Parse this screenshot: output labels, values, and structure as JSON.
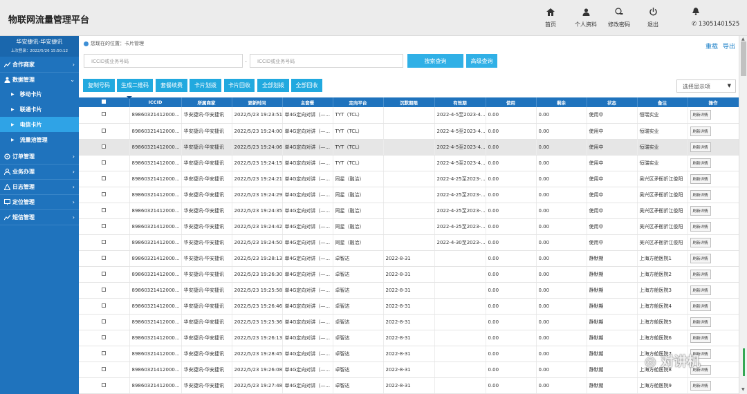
{
  "header": {
    "title": "物联网流量管理平台",
    "nav": [
      {
        "label": "首页",
        "icon": "home-icon"
      },
      {
        "label": "个人资料",
        "icon": "user-icon"
      },
      {
        "label": "修改密码",
        "icon": "key-icon"
      },
      {
        "label": "退出",
        "icon": "power-icon"
      }
    ],
    "phone": "13051401525"
  },
  "sidebar": {
    "user": "华安捷讯-华安捷讯",
    "last_login": "上次登录：2022/5/26 15:50:12",
    "items": [
      {
        "label": "合作商家"
      },
      {
        "label": "数据管理"
      },
      {
        "label": "订单管理"
      },
      {
        "label": "业务办理"
      },
      {
        "label": "日志管理"
      },
      {
        "label": "定位管理"
      },
      {
        "label": "短信管理"
      }
    ],
    "subitems": [
      {
        "label": "移动卡片"
      },
      {
        "label": "联通卡片"
      },
      {
        "label": "电信卡片"
      },
      {
        "label": "流量池管理"
      }
    ]
  },
  "breadcrumb": "您现在的位置：卡片管理",
  "top_links": {
    "refresh": "重载",
    "export": "导出"
  },
  "search": {
    "placeholder1": "ICCID或业务号码",
    "placeholder2": "ICCID或业务号码",
    "star": "-",
    "search_btn": "搜索查询",
    "advanced_btn": "高级查询"
  },
  "toolbar": [
    "复制号码",
    "生成二维码",
    "套餐续费",
    "卡片划拨",
    "卡片回收",
    "全部划拨",
    "全部回收"
  ],
  "display_select": "选择显示项",
  "table": {
    "columns": [
      "ICCID",
      "所属商家",
      "更新时间",
      "主套餐",
      "定向平台",
      "沉默期限",
      "有效期",
      "使用",
      "剩余",
      "状态",
      "备注",
      "操作"
    ],
    "action_label": "刷新详情",
    "rows": [
      {
        "iccid": "89860321412000...",
        "merchant": "华安捷讯-华安捷讯",
        "time": "2022/5/23 19:23:51",
        "plan": "单4G定向对讲（—...",
        "platform": "TYT（TCL）",
        "silent": "",
        "valid": "2022-4-5至2023-4...",
        "used": "0.00",
        "remain": "0.00",
        "status": "使用中",
        "note": "恒瑞实业"
      },
      {
        "iccid": "89860321412000...",
        "merchant": "华安捷讯-华安捷讯",
        "time": "2022/5/23 19:24:00",
        "plan": "单4G定向对讲（—...",
        "platform": "TYT（TCL）",
        "silent": "",
        "valid": "2022-4-5至2023-4...",
        "used": "0.00",
        "remain": "0.00",
        "status": "使用中",
        "note": "恒瑞实业"
      },
      {
        "iccid": "89860321412000...",
        "merchant": "华安捷讯-华安捷讯",
        "time": "2022/5/23 19:24:06",
        "plan": "单4G定向对讲（—...",
        "platform": "TYT（TCL）",
        "silent": "",
        "valid": "2022-4-5至2023-4...",
        "used": "0.00",
        "remain": "0.00",
        "status": "使用中",
        "note": "恒瑞实业"
      },
      {
        "iccid": "89860321412000...",
        "merchant": "华安捷讯-华安捷讯",
        "time": "2022/5/23 19:24:15",
        "plan": "单4G定向对讲（—...",
        "platform": "TYT（TCL）",
        "silent": "",
        "valid": "2022-4-5至2023-4...",
        "used": "0.00",
        "remain": "0.00",
        "status": "使用中",
        "note": "恒瑞实业"
      },
      {
        "iccid": "89860321412000...",
        "merchant": "华安捷讯-华安捷讯",
        "time": "2022/5/23 19:24:21",
        "plan": "单4G定向对讲（—...",
        "platform": "同星（融洽）",
        "silent": "",
        "valid": "2022-4-25至2023-...",
        "used": "0.00",
        "remain": "0.00",
        "status": "使用中",
        "note": "吴兴区矛衙折江俊阳"
      },
      {
        "iccid": "89860321412000...",
        "merchant": "华安捷讯-华安捷讯",
        "time": "2022/5/23 19:24:29",
        "plan": "单4G定向对讲（—...",
        "platform": "同星（融洽）",
        "silent": "",
        "valid": "2022-4-25至2023-...",
        "used": "0.00",
        "remain": "0.00",
        "status": "使用中",
        "note": "吴兴区矛衙折江俊阳"
      },
      {
        "iccid": "89860321412000...",
        "merchant": "华安捷讯-华安捷讯",
        "time": "2022/5/23 19:24:35",
        "plan": "单4G定向对讲（—...",
        "platform": "同星（融洽）",
        "silent": "",
        "valid": "2022-4-25至2023-...",
        "used": "0.00",
        "remain": "0.00",
        "status": "使用中",
        "note": "吴兴区矛衙折江俊阳"
      },
      {
        "iccid": "89860321412000...",
        "merchant": "华安捷讯-华安捷讯",
        "time": "2022/5/23 19:24:42",
        "plan": "单4G定向对讲（—...",
        "platform": "同星（融洽）",
        "silent": "",
        "valid": "2022-4-25至2023-...",
        "used": "0.00",
        "remain": "0.00",
        "status": "使用中",
        "note": "吴兴区矛衙折江俊阳"
      },
      {
        "iccid": "89860321412000...",
        "merchant": "华安捷讯-华安捷讯",
        "time": "2022/5/23 19:24:50",
        "plan": "单4G定向对讲（—...",
        "platform": "同星（融洽）",
        "silent": "",
        "valid": "2022-4-30至2023-...",
        "used": "0.00",
        "remain": "0.00",
        "status": "使用中",
        "note": "吴兴区矛衙折江俊阳"
      },
      {
        "iccid": "89860321412000...",
        "merchant": "华安捷讯-华安捷讯",
        "time": "2022/5/23 19:28:13",
        "plan": "单4G定向对讲（—...",
        "platform": "卓智达",
        "silent": "2022-8-31",
        "valid": "",
        "used": "0.00",
        "remain": "0.00",
        "status": "静默期",
        "note": "上海方舱医院1"
      },
      {
        "iccid": "89860321412000...",
        "merchant": "华安捷讯-华安捷讯",
        "time": "2022/5/23 19:26:30",
        "plan": "单4G定向对讲（—...",
        "platform": "卓智达",
        "silent": "2022-8-31",
        "valid": "",
        "used": "0.00",
        "remain": "0.00",
        "status": "静默期",
        "note": "上海方舱医院2"
      },
      {
        "iccid": "89860321412000...",
        "merchant": "华安捷讯-华安捷讯",
        "time": "2022/5/23 19:25:58",
        "plan": "单4G定向对讲（—...",
        "platform": "卓智达",
        "silent": "2022-8-31",
        "valid": "",
        "used": "0.00",
        "remain": "0.00",
        "status": "静默期",
        "note": "上海方舱医院3"
      },
      {
        "iccid": "89860321412000...",
        "merchant": "华安捷讯-华安捷讯",
        "time": "2022/5/23 19:26:46",
        "plan": "单4G定向对讲（—...",
        "platform": "卓智达",
        "silent": "2022-8-31",
        "valid": "",
        "used": "0.00",
        "remain": "0.00",
        "status": "静默期",
        "note": "上海方舱医院4"
      },
      {
        "iccid": "89860321412000...",
        "merchant": "华安捷讯-华安捷讯",
        "time": "2022/5/23 19:25:36",
        "plan": "单4G定向对讲（—...",
        "platform": "卓智达",
        "silent": "2022-8-31",
        "valid": "",
        "used": "0.00",
        "remain": "0.00",
        "status": "静默期",
        "note": "上海方舱医院5"
      },
      {
        "iccid": "89860321412000...",
        "merchant": "华安捷讯-华安捷讯",
        "time": "2022/5/23 19:26:13",
        "plan": "单4G定向对讲（—...",
        "platform": "卓智达",
        "silent": "2022-8-31",
        "valid": "",
        "used": "0.00",
        "remain": "0.00",
        "status": "静默期",
        "note": "上海方舱医院6"
      },
      {
        "iccid": "89860321412000...",
        "merchant": "华安捷讯-华安捷讯",
        "time": "2022/5/23 19:28:45",
        "plan": "单4G定向对讲（—...",
        "platform": "卓智达",
        "silent": "2022-8-31",
        "valid": "",
        "used": "0.00",
        "remain": "0.00",
        "status": "静默期",
        "note": "上海方舱医院7"
      },
      {
        "iccid": "89860321412000...",
        "merchant": "华安捷讯-华安捷讯",
        "time": "2022/5/23 19:26:08",
        "plan": "单4G定向对讲（—...",
        "platform": "卓智达",
        "silent": "2022-8-31",
        "valid": "",
        "used": "0.00",
        "remain": "0.00",
        "status": "静默期",
        "note": "上海方舱医院8"
      },
      {
        "iccid": "89860321412000...",
        "merchant": "华安捷讯-华安捷讯",
        "time": "2022/5/23 19:27:48",
        "plan": "单4G定向对讲（—...",
        "platform": "卓智达",
        "silent": "2022-8-31",
        "valid": "",
        "used": "0.00",
        "remain": "0.00",
        "status": "静默期",
        "note": "上海方舱医院9"
      }
    ]
  },
  "watermark": "对讲机",
  "colors": {
    "primary": "#1f73bd",
    "accent": "#30b0e6",
    "active_sub": "#2fa3e6"
  }
}
